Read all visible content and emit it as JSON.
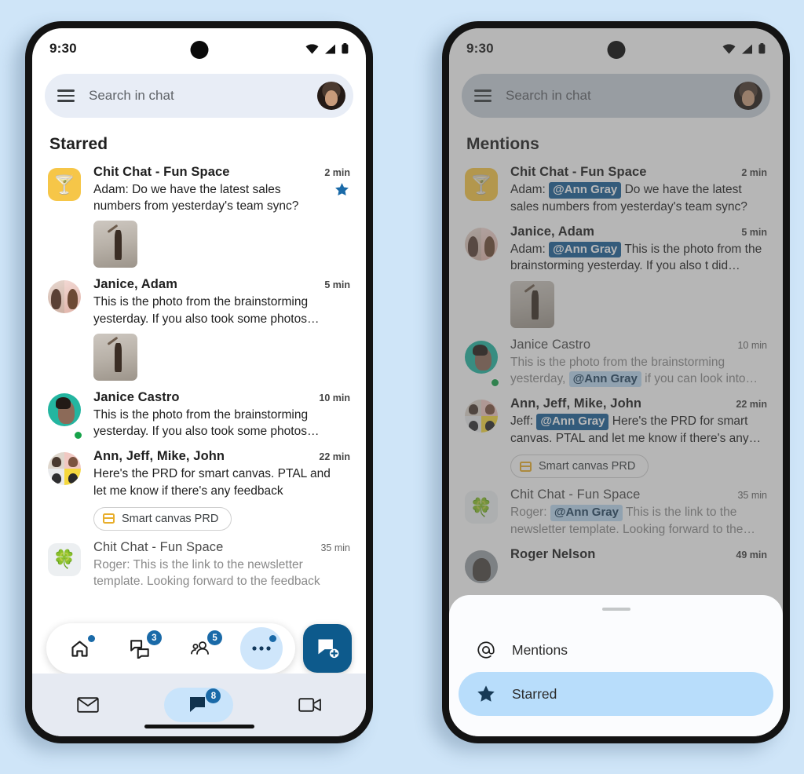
{
  "status_bar": {
    "time": "9:30",
    "icons": [
      "wifi-icon",
      "signal-icon",
      "battery-icon"
    ]
  },
  "search": {
    "placeholder": "Search in chat",
    "menu_icon": "hamburger-menu-icon",
    "avatar": "user-avatar"
  },
  "phone_left": {
    "section_title": "Starred",
    "rows": [
      {
        "avatar_type": "emoji-square",
        "emoji": "🍸",
        "name": "Chit Chat - Fun Space",
        "time": "2 min",
        "snippet": "Adam: Do we have the latest sales numbers from yesterday's team sync?",
        "starred": true,
        "has_thumb": true,
        "read": false
      },
      {
        "avatar_type": "duo",
        "name": "Janice, Adam",
        "time": "5 min",
        "snippet": "This is the photo from the brainstorming yesterday. If you also took some photos…",
        "starred": false,
        "has_thumb": true,
        "read": false
      },
      {
        "avatar_type": "teal-person",
        "name": "Janice Castro",
        "time": "10 min",
        "snippet": "This is the photo from the brainstorming yesterday. If you also took some photos…",
        "starred": false,
        "has_thumb": false,
        "read": false,
        "online": true
      },
      {
        "avatar_type": "quad",
        "name": "Ann, Jeff, Mike, John",
        "time": "22 min",
        "snippet": "Here's the PRD for smart canvas. PTAL and let me know if there's any feedback",
        "starred": false,
        "has_thumb": false,
        "read": false,
        "chip": "Smart canvas PRD"
      },
      {
        "avatar_type": "emoji-square-grey",
        "emoji": "🍀",
        "name": "Chit Chat - Fun Space",
        "time": "35 min",
        "snippet": "Roger: This is the link to the newsletter template. Looking forward to the feedback",
        "starred": false,
        "has_thumb": false,
        "read": true
      }
    ],
    "fab_bar": {
      "items": [
        {
          "icon": "home-icon",
          "badge": "",
          "dot": true,
          "selected": false
        },
        {
          "icon": "chat-bubbles-icon",
          "badge": "3",
          "dot": false,
          "selected": false
        },
        {
          "icon": "spaces-people-icon",
          "badge": "5",
          "dot": false,
          "selected": false
        },
        {
          "icon": "more-dots-icon",
          "badge": "",
          "dot": true,
          "selected": true
        }
      ],
      "compose_button": "new-chat-compose-icon"
    },
    "bottom_nav": [
      {
        "icon": "mail-icon",
        "badge": "",
        "selected": false
      },
      {
        "icon": "chat-icon",
        "badge": "8",
        "selected": true
      },
      {
        "icon": "video-camera-icon",
        "badge": "",
        "selected": false
      }
    ]
  },
  "phone_right": {
    "section_title": "Mentions",
    "rows": [
      {
        "avatar_type": "emoji-square",
        "emoji": "🍸",
        "name": "Chit Chat - Fun Space",
        "time": "2 min",
        "prefix": "Adam:",
        "mention": "@Ann Gray",
        "mention_style": "strong",
        "snippet": "Do we have the latest sales numbers from yesterday's team sync?",
        "has_thumb": false,
        "read": false
      },
      {
        "avatar_type": "duo",
        "name": "Janice, Adam",
        "time": "5 min",
        "prefix": "Adam:",
        "mention": "@Ann Gray",
        "mention_style": "strong",
        "snippet": "This is the photo from the brainstorming yesterday. If you also t  did…",
        "has_thumb": true,
        "read": false
      },
      {
        "avatar_type": "teal-person",
        "name": "Janice Castro",
        "time": "10 min",
        "prefix": "",
        "pre_text": "This is the photo from the brainstorming yesterday,",
        "mention": "@Ann Gray",
        "mention_style": "soft",
        "snippet": "if you can look into…",
        "has_thumb": false,
        "read": true,
        "online": true
      },
      {
        "avatar_type": "quad",
        "name": "Ann, Jeff, Mike, John",
        "time": "22 min",
        "prefix": "Jeff:",
        "mention": "@Ann Gray",
        "mention_style": "strong",
        "snippet": "Here's the PRD for smart canvas. PTAL and let me know if there's any…",
        "has_thumb": false,
        "read": false,
        "chip": "Smart canvas PRD"
      },
      {
        "avatar_type": "emoji-square-grey",
        "emoji": "🍀",
        "name": "Chit Chat - Fun Space",
        "time": "35 min",
        "prefix": "Roger:",
        "mention": "@Ann Gray",
        "mention_style": "soft",
        "snippet": "This is the link to the newsletter template. Looking forward to the…",
        "has_thumb": false,
        "read": true
      },
      {
        "avatar_type": "photo",
        "name": "Roger Nelson",
        "time": "49 min",
        "prefix": "",
        "mention": "",
        "snippet": "",
        "has_thumb": false,
        "read": false
      }
    ],
    "sheet": {
      "grip": "drag-handle",
      "options": [
        {
          "icon": "at-sign-icon",
          "label": "Mentions",
          "active": false
        },
        {
          "icon": "star-icon",
          "label": "Starred",
          "active": true
        }
      ]
    }
  },
  "colors": {
    "background": "#cfe5f8",
    "accent_blue": "#1a6aa8",
    "compose_blue": "#0d5a8c",
    "mention_strong_bg": "#1a5f96",
    "mention_soft_bg": "#bcd9f2",
    "selected_chip": "#b8ddfb",
    "search_bg": "#e8edf6",
    "nav_bg": "#e6eaf2"
  }
}
